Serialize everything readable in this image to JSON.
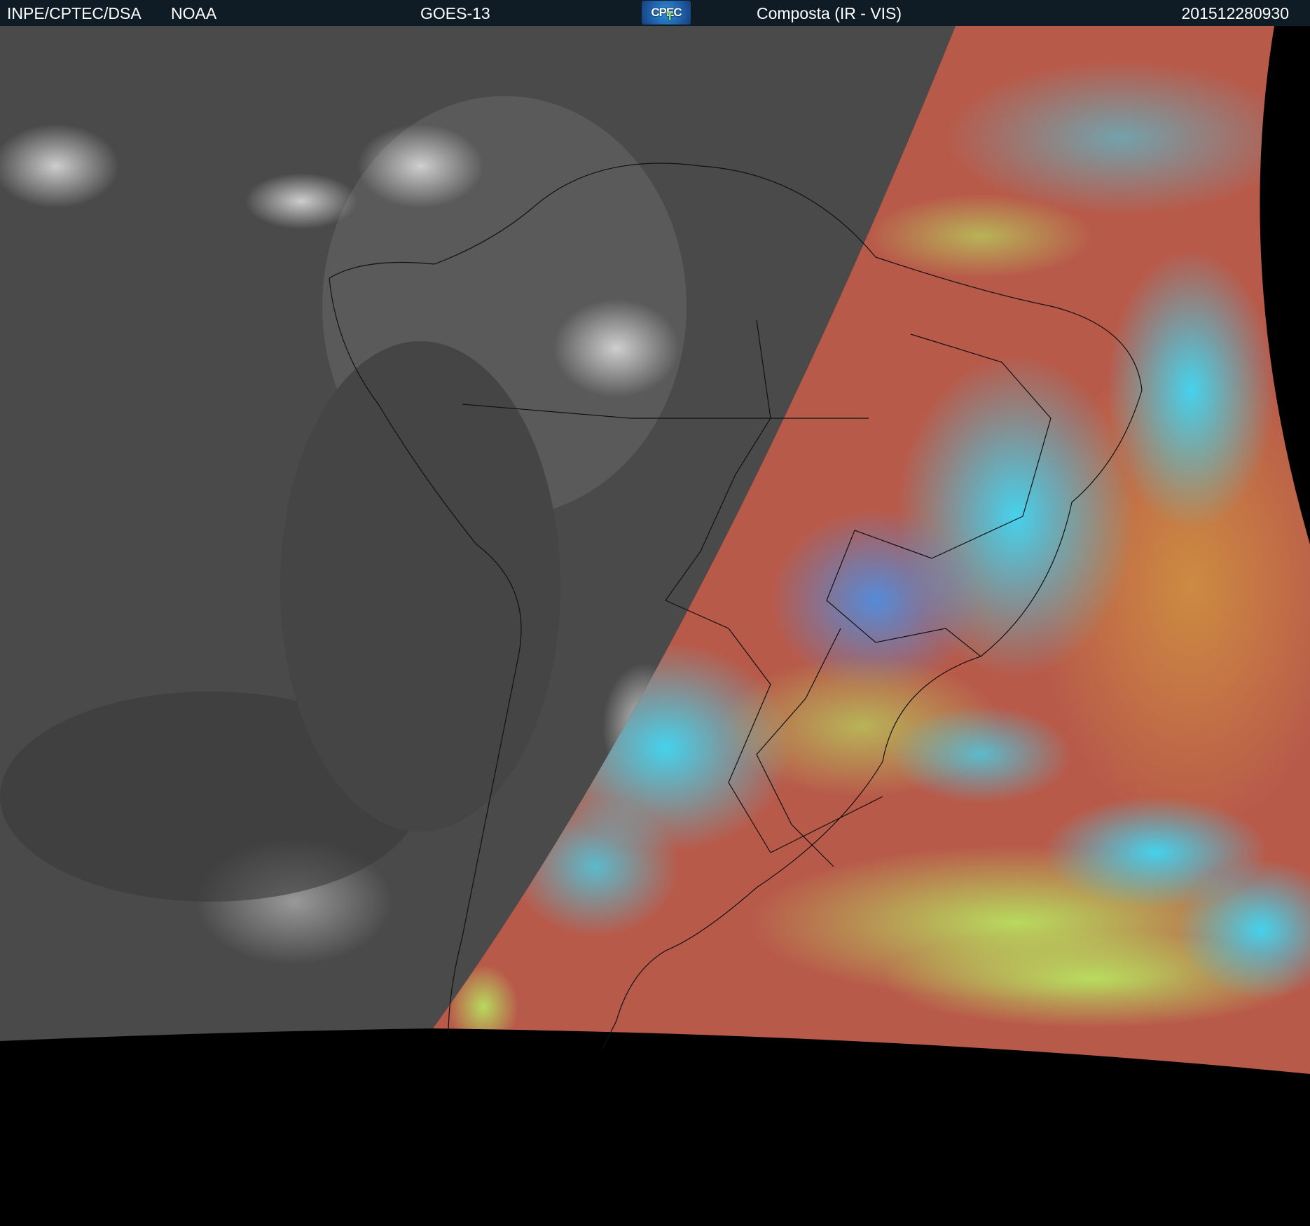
{
  "header": {
    "institution": "INPE/CPTEC/DSA",
    "agency": "NOAA",
    "satellite": "GOES-13",
    "logo_text": "CPTEC",
    "product": "Composta (IR - VIS)",
    "timestamp": "201512280930"
  },
  "colors": {
    "header_bg": "#0f1c25",
    "night_gray": "#4a4a4a",
    "day_red": "#b85a4a",
    "day_cyan": "#3fd0f0",
    "day_green": "#a8e060"
  }
}
